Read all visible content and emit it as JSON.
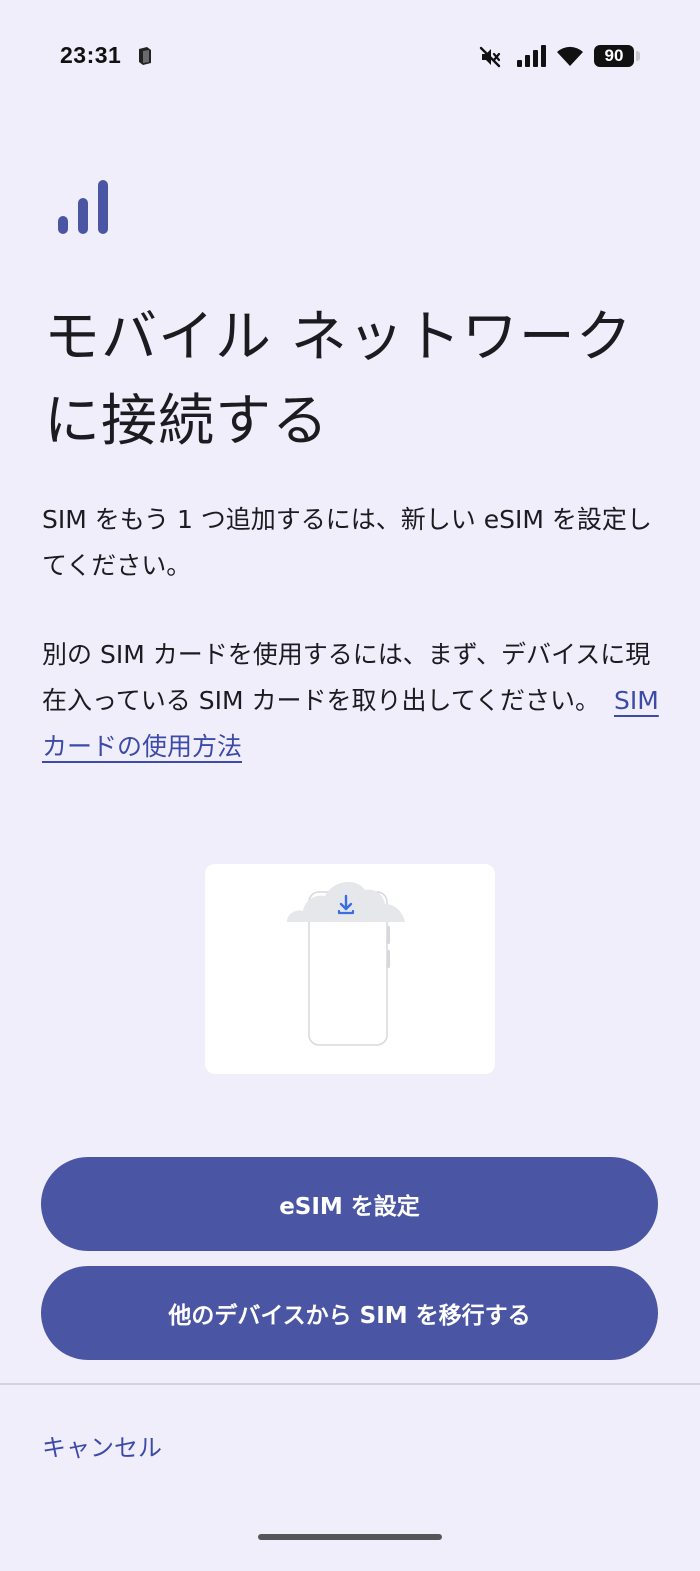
{
  "status_bar": {
    "time": "23:31",
    "battery": "90",
    "icons": [
      "notification-icon",
      "mute-icon",
      "cellular-signal-icon",
      "wifi-icon",
      "battery-icon"
    ]
  },
  "header": {
    "icon": "signal-bars-icon",
    "title": "モバイル ネットワークに接続する"
  },
  "body": {
    "paragraph1": "SIM をもう 1 つ追加するには、新しい eSIM を設定してください。",
    "paragraph2": "別の SIM カードを使用するには、まず、デバイスに現在入っている SIM カードを取り出してください。",
    "help_link": "SIM カードの使用方法"
  },
  "illustration": {
    "icon": "phone-cloud-download-icon"
  },
  "actions": {
    "setup_esim": "eSIM を設定",
    "transfer_sim": "他のデバイスから SIM を移行する",
    "cancel": "キャンセル"
  },
  "colors": {
    "background": "#f1eefc",
    "accent": "#4a56a3",
    "link": "#3d4ba8",
    "text": "#1c1b1f"
  }
}
